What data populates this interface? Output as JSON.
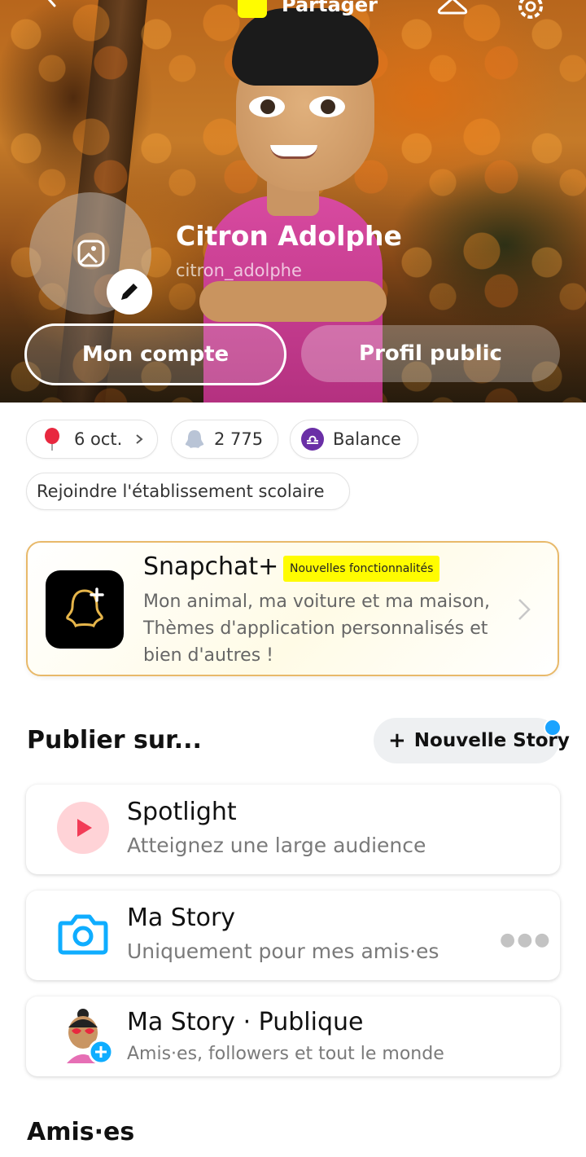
{
  "header": {
    "share_label": "Partager",
    "icons": [
      "back-icon",
      "snapcode-icon",
      "hanger-icon",
      "gear-icon"
    ]
  },
  "profile": {
    "name": "Citron Adolphe",
    "username": "citron_adolphe",
    "account_button": "Mon compte",
    "public_profile_button": "Profil public"
  },
  "chips": {
    "birthday": "6 oct.",
    "snap_score": "2 775",
    "zodiac": "Balance",
    "school": "Rejoindre l'établissement scolaire"
  },
  "snapchat_plus": {
    "title": "Snapchat+",
    "badge": "Nouvelles fonctionnalités",
    "description": "Mon animal, ma voiture et ma maison, Thèmes d'application personnalisés et bien d'autres !"
  },
  "publish": {
    "title": "Publier sur...",
    "new_story": "Nouvelle Story",
    "items": [
      {
        "title": "Spotlight",
        "subtitle": "Atteignez une large audience"
      },
      {
        "title": "Ma Story",
        "subtitle": "Uniquement pour mes amis·es"
      },
      {
        "title": "Ma Story · Publique",
        "subtitle": "Amis·es, followers et tout le monde"
      }
    ]
  },
  "friends": {
    "title": "Amis·es"
  },
  "colors": {
    "snap_yellow": "#fffc00",
    "spotlight_red": "#f23c57",
    "camera_blue": "#0fadff",
    "plus_border": "#e8b96a"
  }
}
